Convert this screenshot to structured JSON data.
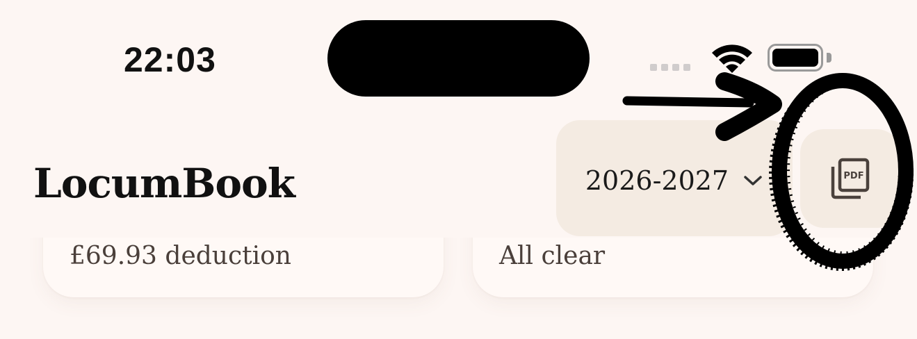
{
  "status_bar": {
    "time": "22:03"
  },
  "header": {
    "title": "LocumBook",
    "year_selector": {
      "value": "2026-2027",
      "icon": "chevron-down-icon"
    },
    "pdf_button": {
      "icon": "pdf-export-icon",
      "icon_text": "PDF"
    }
  },
  "cards": [
    {
      "subtitle": "£69.93 deduction"
    },
    {
      "subtitle": "All clear"
    }
  ],
  "annotation": {
    "arrow_icon": "arrow-right-icon",
    "circle": "circle-highlight"
  },
  "colors": {
    "background": "#fdf6f3",
    "button_bg": "#f4ebe2",
    "text": "#111111",
    "card_text": "#4a3f3a"
  }
}
